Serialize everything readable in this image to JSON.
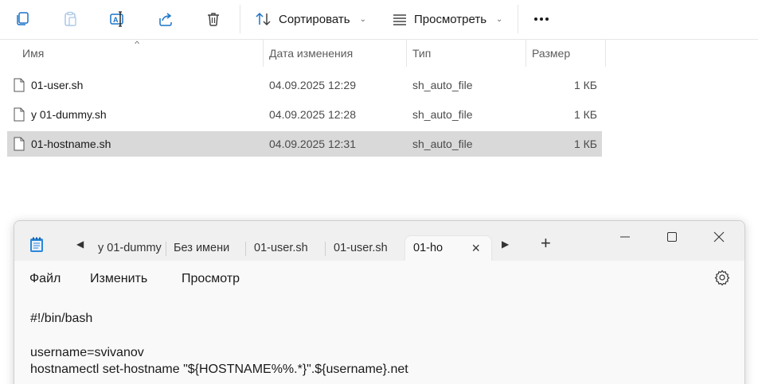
{
  "toolbar": {
    "icons": [
      "copy-icon",
      "paste-icon",
      "rename-icon",
      "share-icon",
      "delete-icon"
    ],
    "sort_label": "Сортировать",
    "view_label": "Просмотреть"
  },
  "columns": {
    "name": "Имя",
    "date": "Дата изменения",
    "type": "Тип",
    "size": "Размер"
  },
  "files": [
    {
      "name": "01-user.sh",
      "date": "04.09.2025 12:29",
      "type": "sh_auto_file",
      "size": "1 КБ"
    },
    {
      "name": "у 01-dummy.sh",
      "date": "04.09.2025 12:28",
      "type": "sh_auto_file",
      "size": "1 КБ"
    },
    {
      "name": "01-hostname.sh",
      "date": "04.09.2025 12:31",
      "type": "sh_auto_file",
      "size": "1 КБ"
    }
  ],
  "notepad": {
    "tabs": [
      {
        "label": "у 01-dummy"
      },
      {
        "label": "Без имени"
      },
      {
        "label": "01-user.sh"
      },
      {
        "label": "01-user.sh"
      },
      {
        "label": "01-ho"
      }
    ],
    "new_tab": "+",
    "menu": {
      "file": "Файл",
      "edit": "Изменить",
      "view": "Просмотр"
    },
    "content": [
      "#!/bin/bash",
      "",
      "username=svivanov",
      "hostnamectl set-hostname \"${HOSTNAME%%.*}\".${username}.net"
    ]
  },
  "colors": {
    "accent": "#0067c0",
    "selected_row": "#d9d9d9",
    "icon_blue": "#1a73c8"
  }
}
